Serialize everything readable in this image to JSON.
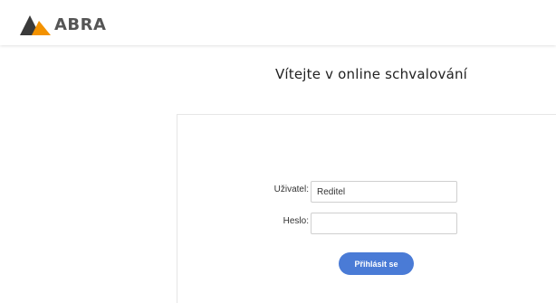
{
  "header": {
    "brand": "ABRA"
  },
  "main": {
    "welcome_title": "Vítejte v online schvalování"
  },
  "login_form": {
    "user_label": "Uživatel:",
    "user_value": "Reditel",
    "password_label": "Heslo:",
    "password_value": "",
    "submit_label": "Přihlásit se"
  },
  "colors": {
    "logo_dark": "#3a3a3a",
    "logo_orange": "#f39200",
    "button_blue": "#4a7bd6"
  }
}
